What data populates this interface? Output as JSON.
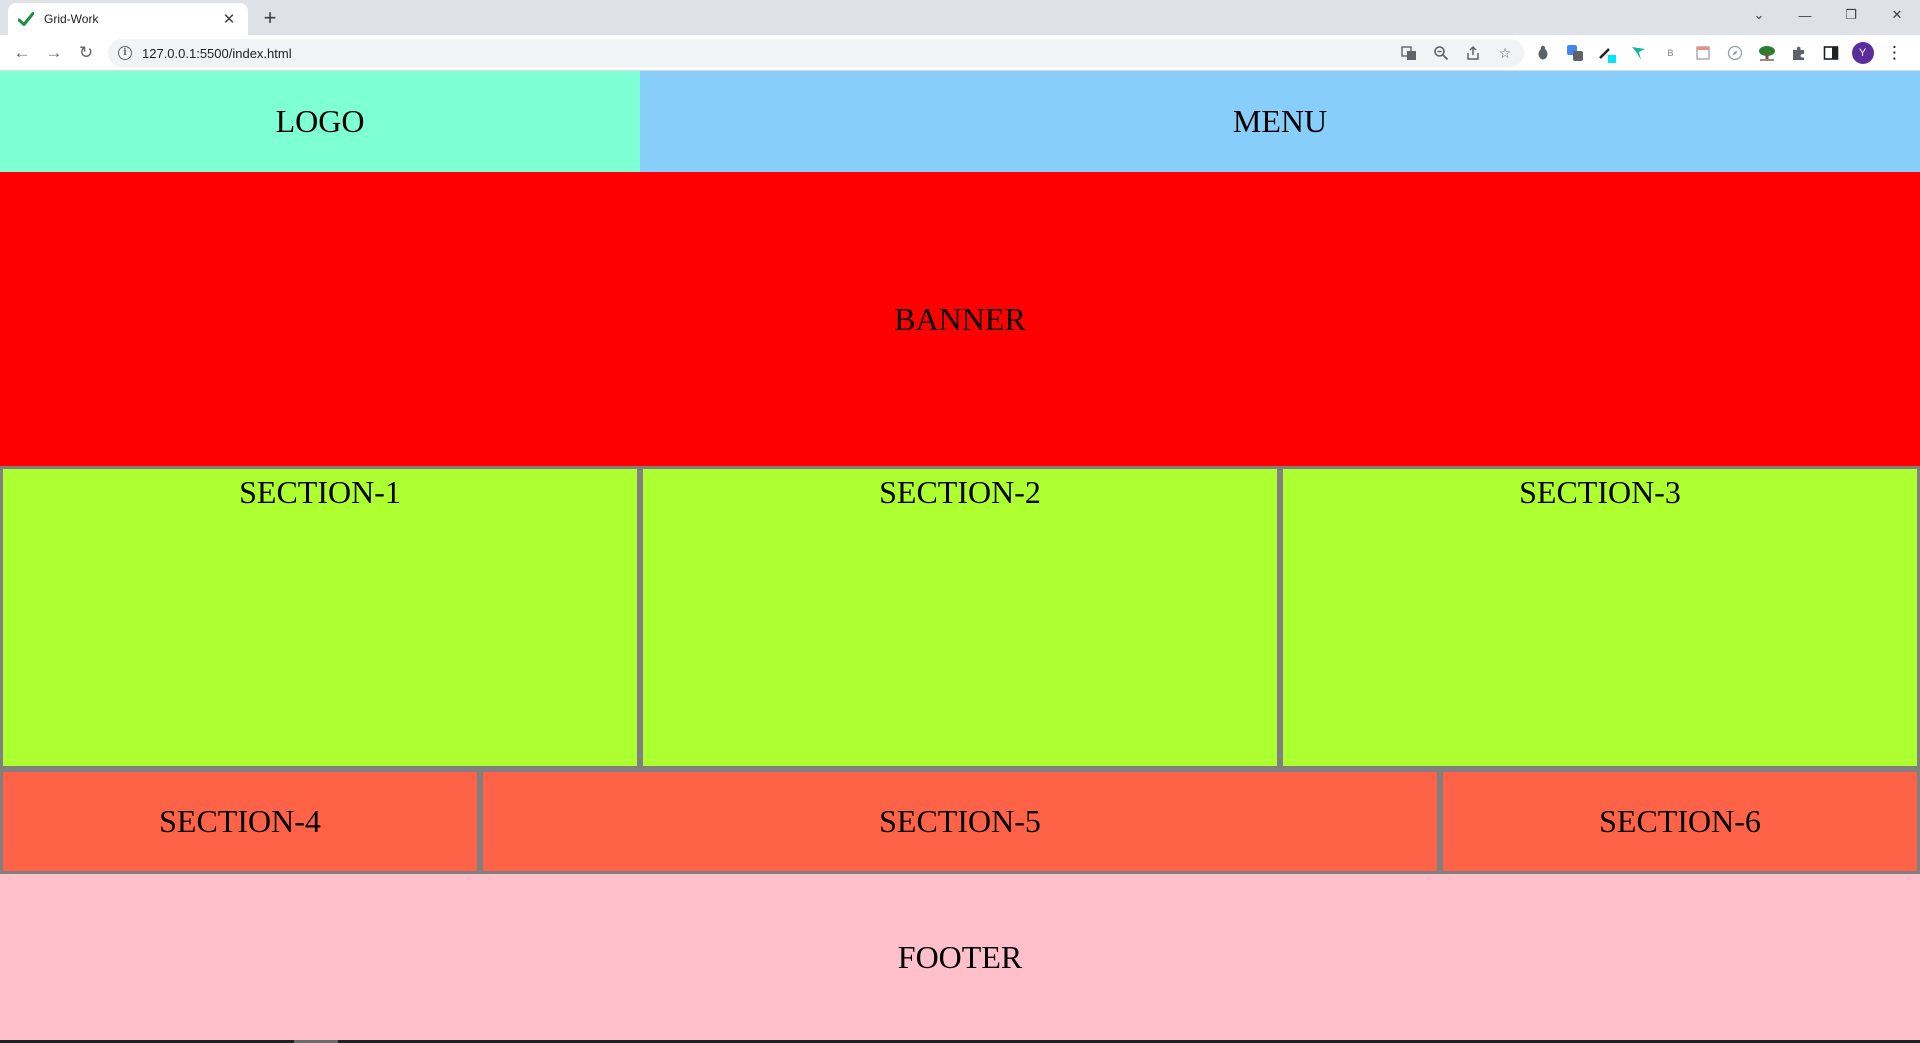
{
  "browser": {
    "tab_title": "Grid-Work",
    "tab_close_glyph": "✕",
    "new_tab_glyph": "+",
    "url": "127.0.0.1:5500/index.html",
    "window_controls": {
      "tab_search": "⌄",
      "minimize": "—",
      "restore": "❐",
      "close": "✕"
    },
    "nav": {
      "back": "←",
      "forward": "→",
      "reload": "↻"
    },
    "omnibox_icons": [
      "translate-icon",
      "zoom-icon",
      "share-icon",
      "bookmark-star-icon"
    ],
    "extension_icons": [
      "extension-bug-icon",
      "extension-translate-icon",
      "extension-eyedropper-icon",
      "extension-bird-icon",
      "extension-b-icon",
      "extension-calendar-icon",
      "extension-compass-icon",
      "extension-tree-icon",
      "extensions-puzzle-icon",
      "side-panel-icon"
    ],
    "profile_initial": "Y",
    "menu_glyph": "⋮"
  },
  "page": {
    "logo": "LOGO",
    "menu": "MENU",
    "banner": "BANNER",
    "section_1": "SECTION-1",
    "section_2": "SECTION-2",
    "section_3": "SECTION-3",
    "section_4": "SECTION-4",
    "section_5": "SECTION-5",
    "section_6": "SECTION-6",
    "footer": "FOOTER"
  },
  "colors": {
    "logo_bg": "#7fffd4",
    "menu_bg": "#87cefa",
    "banner_bg": "#ff0000",
    "sections_top_bg": "#adff2f",
    "sections_bottom_bg": "#ff6347",
    "footer_bg": "#ffc0cb",
    "border": "#808080"
  }
}
